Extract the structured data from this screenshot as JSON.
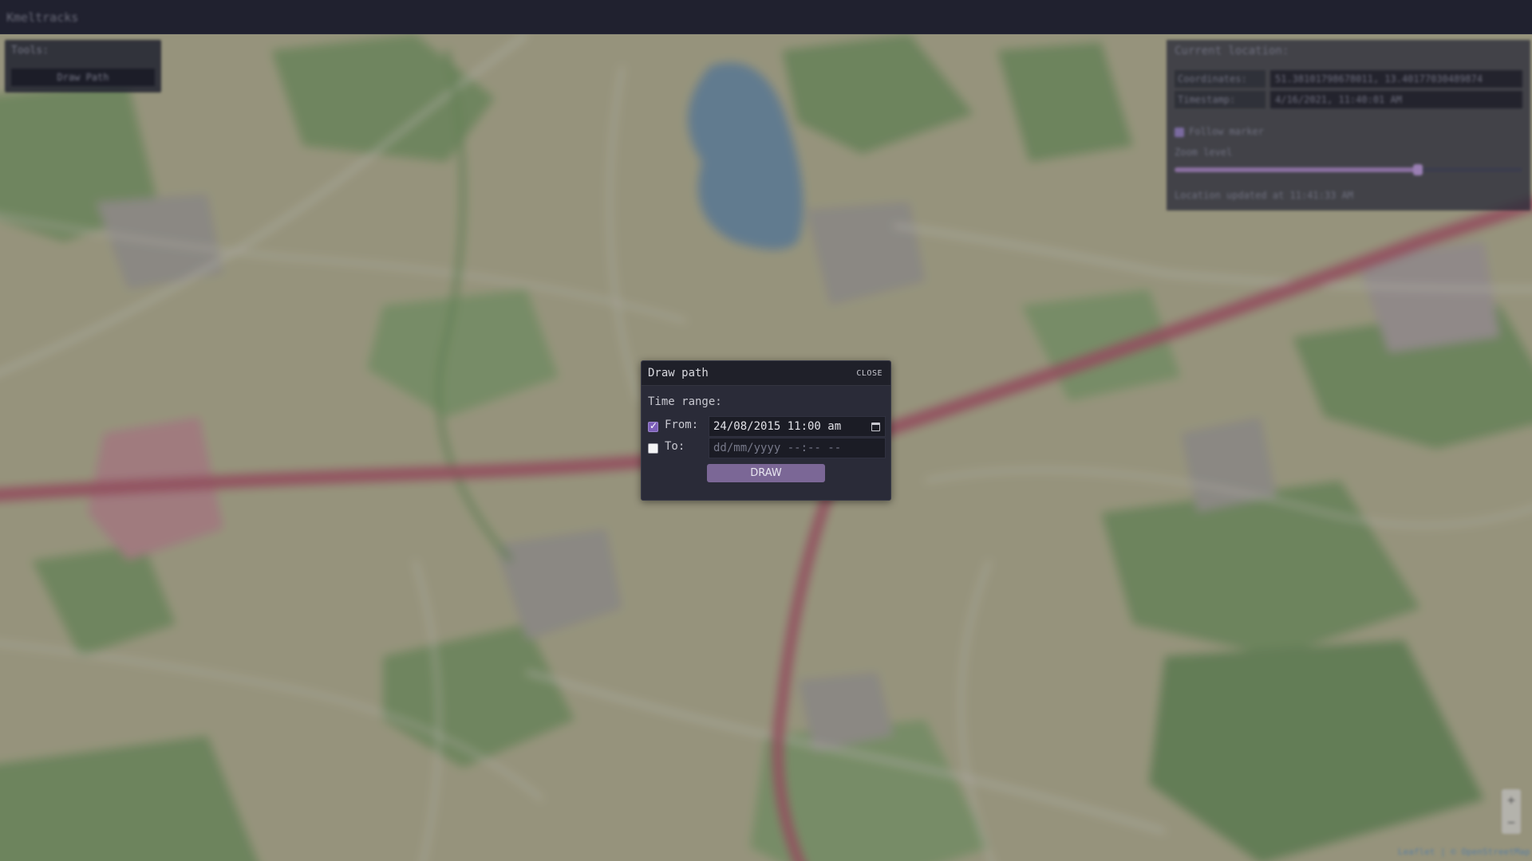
{
  "app": {
    "title": "Kmeltracks"
  },
  "tools": {
    "title": "Tools:",
    "draw_path_button": "Draw Path"
  },
  "location_panel": {
    "title": "Current location:",
    "coordinates_label": "Coordinates:",
    "coordinates_value": "51.38101798678011, 13.40177030489874",
    "timestamp_label": "Timestamp:",
    "timestamp_value": "4/16/2021, 11:40:01 AM",
    "follow_label": "Follow marker",
    "zoom_label": "Zoom level",
    "zoom_level_fraction": 0.7,
    "updated_text": "Location updated at 11:41:33 AM"
  },
  "map": {
    "zoom_in": "+",
    "zoom_out": "−",
    "attribution": "Leaflet | © OpenStreetMap",
    "colors": {
      "land": "#a8a588",
      "forest": "#7a9467",
      "motorway": "#a45a69",
      "water": "#6d8aa0",
      "road": "#c2c0b6"
    }
  },
  "dialog": {
    "title": "Draw path",
    "close_label": "CLOSE",
    "time_range_label": "Time range:",
    "from_label": "From:",
    "from_checked": true,
    "from_value": "24/08/2015 11:00 am",
    "to_label": "To:",
    "to_checked": false,
    "to_placeholder": "dd/mm/yyyy --:-- --",
    "draw_button": "DRAW"
  }
}
